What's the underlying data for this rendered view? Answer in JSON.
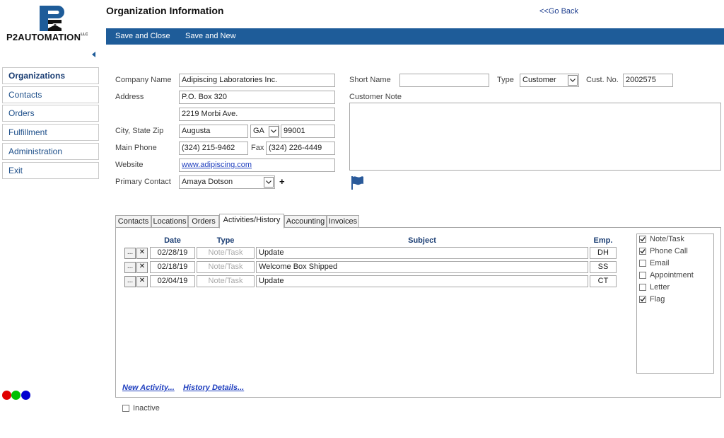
{
  "logo": {
    "text": "P2AUTOMATION",
    "suffix": "LLC"
  },
  "header": {
    "title": "Organization Information",
    "go_back": "<<Go Back"
  },
  "toolbar": {
    "save_close": "Save and Close",
    "save_new": "Save and New"
  },
  "sidebar": {
    "items": [
      {
        "label": "Organizations"
      },
      {
        "label": "Contacts"
      },
      {
        "label": "Orders"
      },
      {
        "label": "Fulfillment"
      },
      {
        "label": "Administration"
      },
      {
        "label": "Exit"
      }
    ]
  },
  "form": {
    "company_name_label": "Company Name",
    "company_name": "Adipiscing Laboratories Inc.",
    "address_label": "Address",
    "address1": "P.O. Box 320",
    "address2": "2219 Morbi Ave.",
    "city_label": "City, State Zip",
    "city": "Augusta",
    "state": "GA",
    "zip": "99001",
    "phone_label": "Main Phone",
    "phone": "(324) 215-9462",
    "fax_label": "Fax",
    "fax": "(324) 226-4449",
    "website_label": "Website",
    "website": "www.adipiscing.com",
    "contact_label": "Primary Contact",
    "contact": "Amaya Dotson",
    "plus": "+",
    "short_name_label": "Short Name",
    "short_name": "",
    "type_label": "Type",
    "type": "Customer",
    "cust_no_label": "Cust. No.",
    "cust_no": "2002575",
    "note_label": "Customer Note",
    "note": ""
  },
  "tabs": [
    {
      "label": "Contacts"
    },
    {
      "label": "Locations"
    },
    {
      "label": "Orders"
    },
    {
      "label": "Activities/History"
    },
    {
      "label": "Accounting"
    },
    {
      "label": "Invoices"
    }
  ],
  "activities": {
    "headers": {
      "date": "Date",
      "type": "Type",
      "subject": "Subject",
      "emp": "Emp."
    },
    "edit_glyph": "...",
    "delete_glyph": "✕",
    "rows": [
      {
        "date": "02/28/19",
        "type": "Note/Task",
        "subject": "Update",
        "emp": "DH"
      },
      {
        "date": "02/18/19",
        "type": "Note/Task",
        "subject": "Welcome Box Shipped",
        "emp": "SS"
      },
      {
        "date": "02/04/19",
        "type": "Note/Task",
        "subject": "Update",
        "emp": "CT"
      }
    ],
    "filters": [
      {
        "label": "Note/Task",
        "checked": true
      },
      {
        "label": "Phone Call",
        "checked": true
      },
      {
        "label": "Email",
        "checked": false
      },
      {
        "label": "Appointment",
        "checked": false
      },
      {
        "label": "Letter",
        "checked": false
      },
      {
        "label": "Flag",
        "checked": true
      }
    ],
    "new_activity": "New Activity...",
    "history_details": "History Details..."
  },
  "inactive": {
    "label": "Inactive",
    "checked": false
  },
  "colors": {
    "toolbar": "#1e5c99",
    "flag": "#2a5a9a",
    "dot_red": "#e00000",
    "dot_green": "#00c000",
    "dot_blue": "#0000d0"
  }
}
